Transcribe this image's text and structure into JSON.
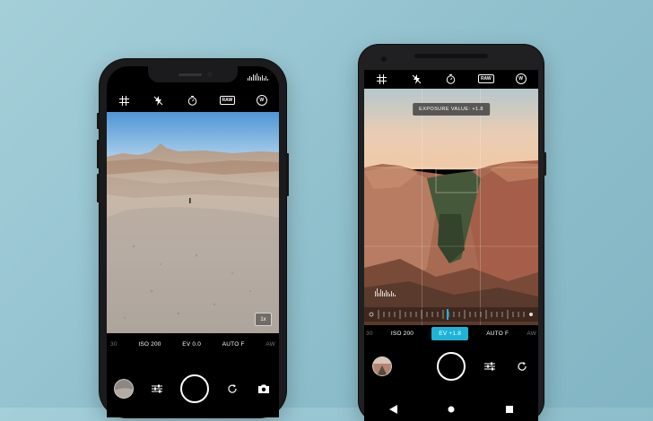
{
  "iphone": {
    "toolbar_icons": [
      "grid-icon",
      "flash-off-icon",
      "timer-icon",
      "raw-badge",
      "white-balance-icon"
    ],
    "raw_label": "RAW",
    "wb_label": "W",
    "zoom_label": "1x",
    "settings": {
      "prev": "30",
      "iso": "ISO 200",
      "ev": "EV 0.0",
      "focus": "AUTO F",
      "next": "AW"
    },
    "controls": [
      "gallery-thumbnail",
      "adjust-sliders-icon",
      "shutter-button",
      "switch-camera-icon",
      "camera-mode-icon"
    ]
  },
  "pixel": {
    "toolbar_icons": [
      "grid-icon",
      "flash-off-icon",
      "timer-icon",
      "raw-badge",
      "white-balance-icon"
    ],
    "raw_label": "RAW",
    "wb_label": "W",
    "hint": "EXPOSURE VALUE: +1.8",
    "ev_slider_level": 0.47,
    "settings": {
      "prev": "30",
      "iso": "ISO 200",
      "ev": "EV +1.8",
      "focus": "AUTO F",
      "next": "AW"
    },
    "navbar": [
      "back-icon",
      "home-icon",
      "overview-icon"
    ]
  },
  "colors": {
    "background": "#94c4d0",
    "accent": "#1eb3d6"
  }
}
